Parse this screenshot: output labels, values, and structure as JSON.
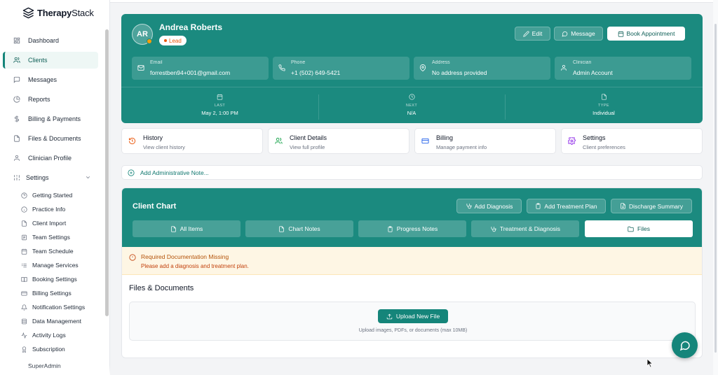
{
  "app": {
    "brand_bold": "Therapy",
    "brand_light": "Stack",
    "brand_color": "#15857a"
  },
  "sidebar": {
    "items": [
      {
        "label": "Dashboard",
        "icon": "grid-icon"
      },
      {
        "label": "Clients",
        "icon": "users-icon",
        "active": true
      },
      {
        "label": "Messages",
        "icon": "message-icon"
      },
      {
        "label": "Reports",
        "icon": "pie-chart-icon"
      },
      {
        "label": "Billing & Payments",
        "icon": "dollar-icon"
      },
      {
        "label": "Files & Documents",
        "icon": "file-icon"
      },
      {
        "label": "Clinician Profile",
        "icon": "user-icon"
      }
    ],
    "settings_label": "Settings",
    "settings_items": [
      {
        "label": "Getting Started",
        "icon": "help-circle-icon"
      },
      {
        "label": "Practice Info",
        "icon": "info-icon"
      },
      {
        "label": "Client Import",
        "icon": "import-icon"
      },
      {
        "label": "Team Settings",
        "icon": "team-icon"
      },
      {
        "label": "Team Schedule",
        "icon": "calendar-icon"
      },
      {
        "label": "Manage Services",
        "icon": "list-icon"
      },
      {
        "label": "Booking Settings",
        "icon": "book-icon"
      },
      {
        "label": "Billing Settings",
        "icon": "credit-card-icon"
      },
      {
        "label": "Notification Settings",
        "icon": "bell-icon"
      },
      {
        "label": "Data Management",
        "icon": "database-icon"
      },
      {
        "label": "Activity Logs",
        "icon": "activity-icon"
      },
      {
        "label": "Subscription",
        "icon": "award-icon"
      },
      {
        "label": "SuperAdmin",
        "icon": "shield-icon"
      }
    ]
  },
  "client": {
    "initials": "AR",
    "name": "Andrea Roberts",
    "status": "Lead",
    "status_color": "#ea580c",
    "actions": {
      "edit": "Edit",
      "message": "Message",
      "book": "Book Appointment"
    },
    "info": [
      {
        "key": "Email",
        "value": "forrestben94+001@gmail.com",
        "icon": "mail-icon"
      },
      {
        "key": "Phone",
        "value": "+1 (502) 649-5421",
        "icon": "phone-icon"
      },
      {
        "key": "Address",
        "value": "No address provided",
        "icon": "map-pin-icon"
      },
      {
        "key": "Clinician",
        "value": "Admin Account",
        "icon": "user-icon"
      }
    ],
    "stats": [
      {
        "key": "LAST",
        "value": "May 2, 1:00 PM",
        "icon": "calendar-icon"
      },
      {
        "key": "NEXT",
        "value": "N/A",
        "icon": "clock-icon"
      },
      {
        "key": "TYPE",
        "value": "Individual",
        "icon": "file-icon"
      }
    ]
  },
  "tiles": [
    {
      "title": "History",
      "subtitle": "View client history",
      "icon": "history-icon",
      "color": "#ea580c"
    },
    {
      "title": "Client Details",
      "subtitle": "View full profile",
      "icon": "users-icon",
      "color": "#16a34a"
    },
    {
      "title": "Billing",
      "subtitle": "Manage payment info",
      "icon": "credit-card-icon",
      "color": "#2563eb"
    },
    {
      "title": "Settings",
      "subtitle": "Client preferences",
      "icon": "gear-icon",
      "color": "#9333ea"
    }
  ],
  "note": {
    "label": "Add Administrative Note..."
  },
  "chart": {
    "title": "Client Chart",
    "actions": {
      "diagnosis": "Add Diagnosis",
      "treatment": "Add Treatment Plan",
      "discharge": "Discharge Summary"
    },
    "tabs": [
      {
        "label": "All Items",
        "icon": "file-icon"
      },
      {
        "label": "Chart Notes",
        "icon": "file-icon"
      },
      {
        "label": "Progress Notes",
        "icon": "clipboard-icon"
      },
      {
        "label": "Treatment & Diagnosis",
        "icon": "stethoscope-icon"
      },
      {
        "label": "Files",
        "icon": "folder-icon",
        "active": true
      }
    ],
    "alert": {
      "title": "Required Documentation Missing",
      "message": "Please add a diagnosis and treatment plan."
    },
    "files_title": "Files & Documents",
    "upload_label": "Upload New File",
    "upload_hint": "Upload images, PDFs, or documents (max 10MB)"
  }
}
